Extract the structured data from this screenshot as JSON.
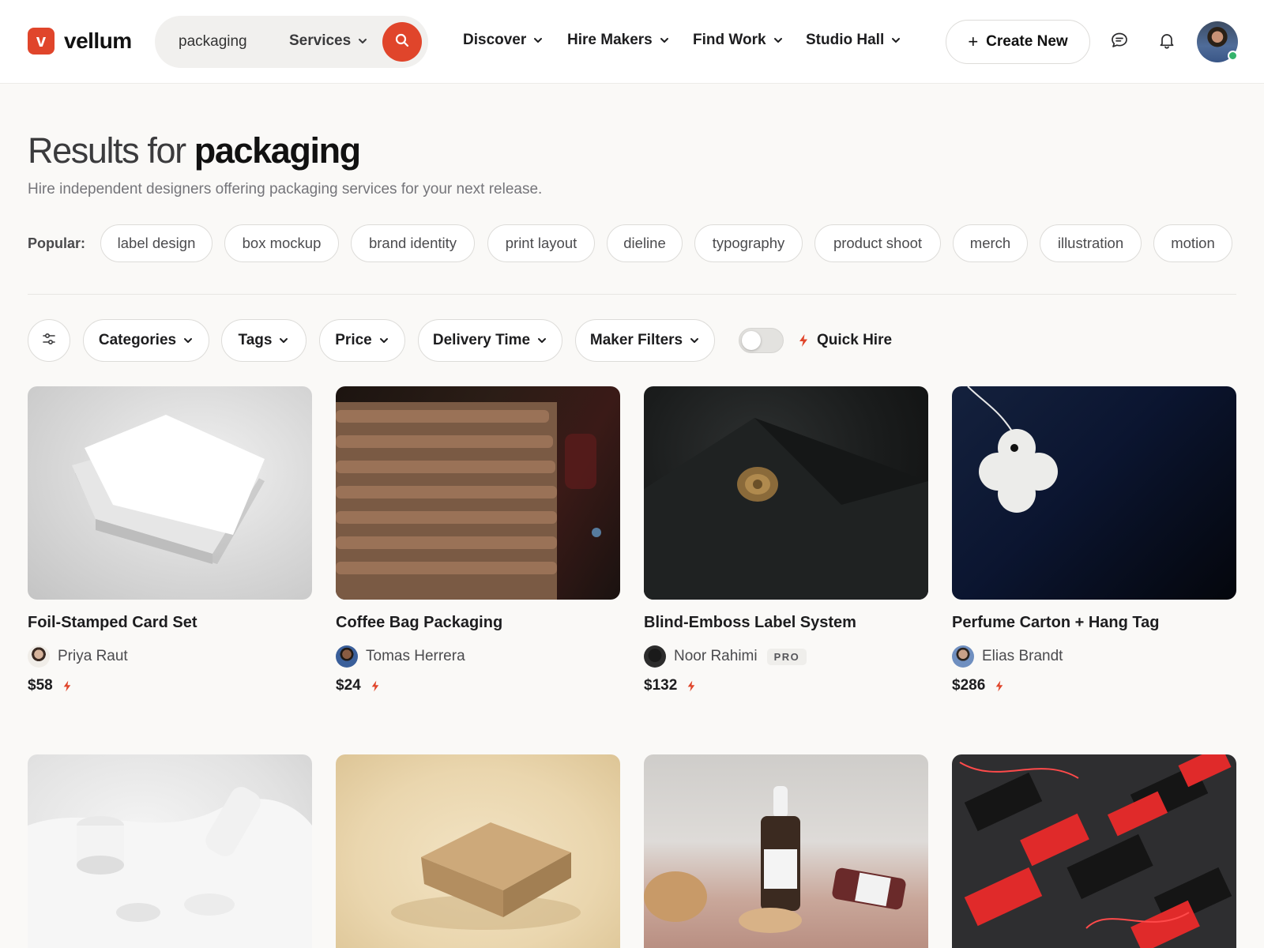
{
  "brand": {
    "logo_letter": "v",
    "name": "vellum",
    "accent": "#e0452b"
  },
  "search": {
    "value": "packaging",
    "category": "Services"
  },
  "nav": [
    "Discover",
    "Hire Makers",
    "Find Work",
    "Studio Hall"
  ],
  "header_actions": {
    "create_label": "Create New"
  },
  "results": {
    "prefix": "Results for ",
    "query": "packaging",
    "subtitle": "Hire independent designers offering packaging services for your next release."
  },
  "popular": {
    "label": "Popular:",
    "tags": [
      "label design",
      "box mockup",
      "brand identity",
      "print layout",
      "dieline",
      "typography",
      "product shoot",
      "merch",
      "illustration",
      "motion"
    ]
  },
  "filters": {
    "items": [
      "Categories",
      "Tags",
      "Price",
      "Delivery Time",
      "Maker Filters"
    ],
    "quick_hire_label": "Quick Hire",
    "quick_hire_on": false
  },
  "cards": [
    {
      "title": "Foil-Stamped Card Set",
      "maker": "Priya Raut",
      "pro": false,
      "price": "$58",
      "quick_hire": true
    },
    {
      "title": "Coffee Bag Packaging",
      "maker": "Tomas Herrera",
      "pro": false,
      "price": "$24",
      "quick_hire": true
    },
    {
      "title": "Blind-Emboss Label System",
      "maker": "Noor Rahimi",
      "pro": true,
      "pro_label": "PRO",
      "price": "$132",
      "quick_hire": true
    },
    {
      "title": "Perfume Carton + Hang Tag",
      "maker": "Elias Brandt",
      "pro": false,
      "price": "$286",
      "quick_hire": true
    }
  ]
}
